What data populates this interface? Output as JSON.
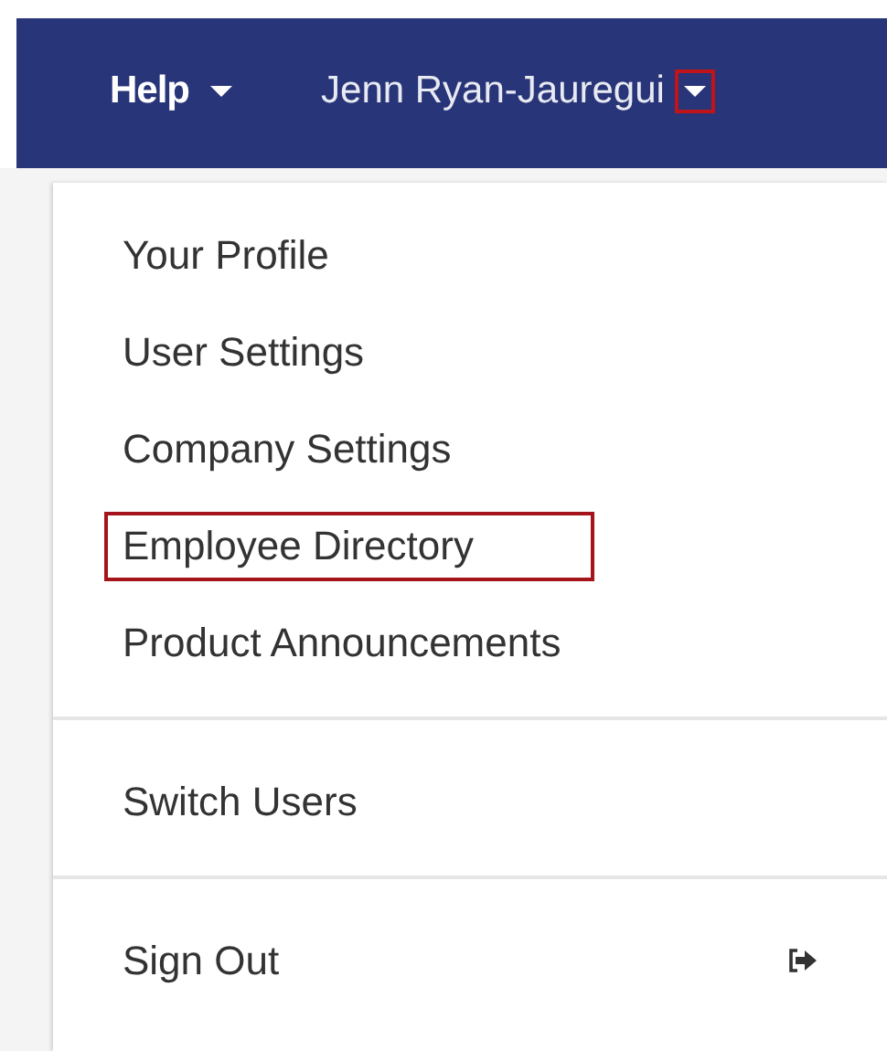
{
  "navbar": {
    "items": [
      {
        "label": "Help",
        "bold": true,
        "highlighted": false
      },
      {
        "label": "Jenn Ryan-Jauregui",
        "bold": false,
        "highlighted": true
      }
    ]
  },
  "menu": {
    "sections": [
      {
        "items": [
          {
            "label": "Your Profile",
            "highlighted": false,
            "kind": "plain"
          },
          {
            "label": "User Settings",
            "highlighted": false,
            "kind": "plain"
          },
          {
            "label": "Company Settings",
            "highlighted": false,
            "kind": "plain"
          },
          {
            "label": "Employee Directory",
            "highlighted": true,
            "kind": "plain"
          },
          {
            "label": "Product Announcements",
            "highlighted": false,
            "kind": "plain"
          }
        ]
      },
      {
        "items": [
          {
            "label": "Switch Users",
            "highlighted": false,
            "kind": "plain"
          }
        ]
      },
      {
        "items": [
          {
            "label": "Sign Out",
            "highlighted": false,
            "kind": "exit"
          }
        ]
      }
    ]
  }
}
